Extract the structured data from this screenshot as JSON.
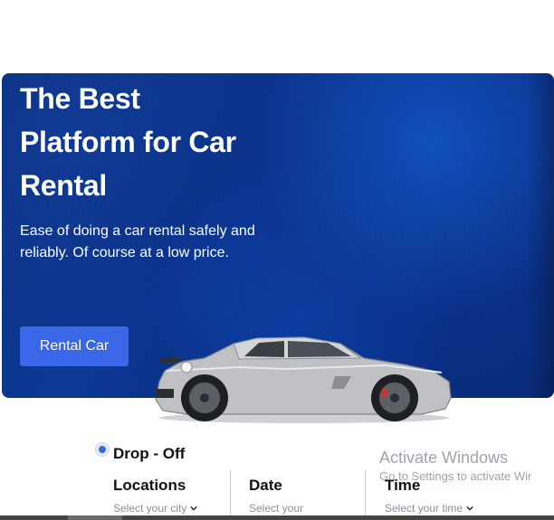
{
  "hero": {
    "title": "The Best\nPlatform for Car\nRental",
    "subtitle": "Ease of doing a car rental safely and reliably. Of course at a low price.",
    "cta_label": "Rental Car"
  },
  "search": {
    "mode_label": "Drop - Off",
    "fields": [
      {
        "label": "Locations",
        "placeholder": "Select your city"
      },
      {
        "label": "Date",
        "placeholder": "Select your"
      },
      {
        "label": "Time",
        "placeholder": "Select your time"
      }
    ]
  },
  "watermark": {
    "title": "Activate Windows",
    "subtitle": "Go to Settings to activate Wir"
  },
  "colors": {
    "accent": "#3a67e8",
    "hero_bg": "#0b3a98"
  }
}
